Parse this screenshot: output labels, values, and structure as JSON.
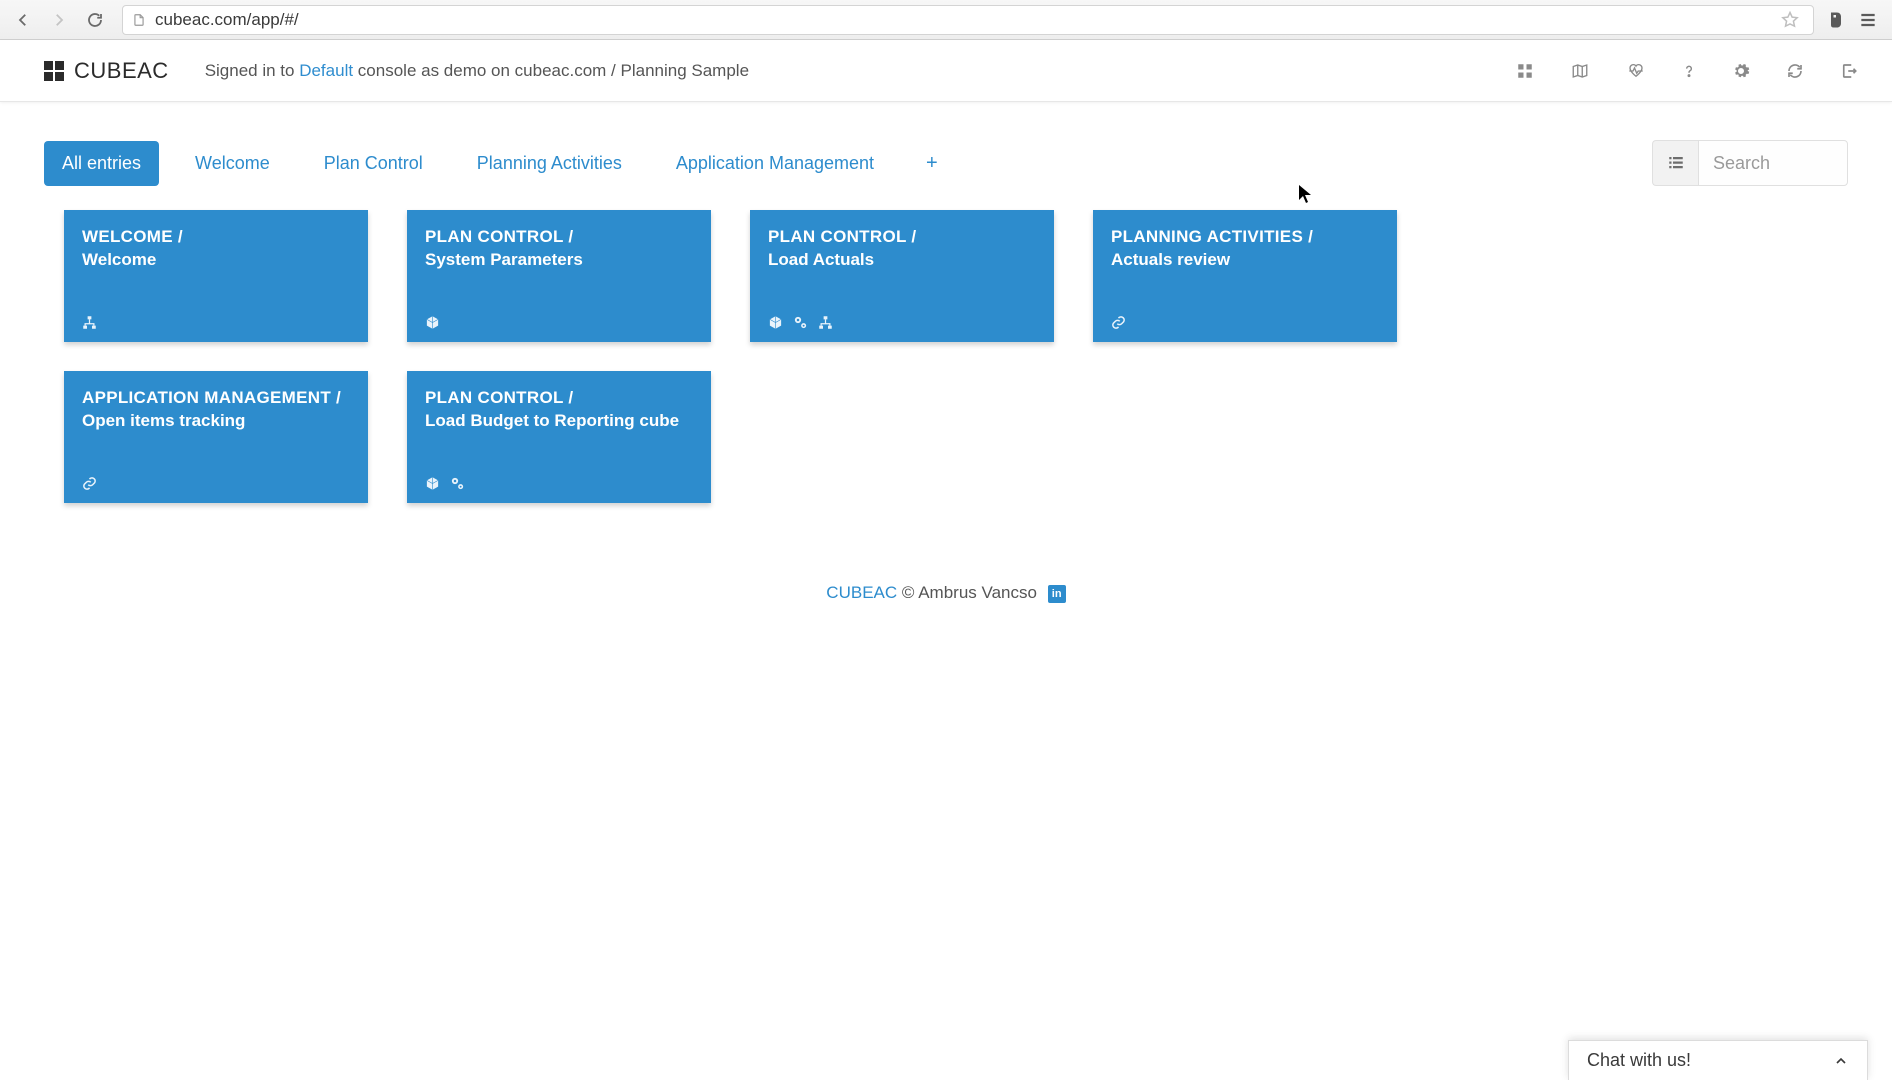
{
  "browser": {
    "url": "cubeac.com/app/#/"
  },
  "header": {
    "brand": "CUBEAC",
    "signed_in_prefix": "Signed in to ",
    "signed_in_link": "Default",
    "signed_in_suffix": " console as demo on cubeac.com / Planning Sample"
  },
  "tabs": [
    {
      "label": "All entries",
      "active": true
    },
    {
      "label": "Welcome",
      "active": false
    },
    {
      "label": "Plan Control",
      "active": false
    },
    {
      "label": "Planning Activities",
      "active": false
    },
    {
      "label": "Application Management",
      "active": false
    }
  ],
  "add_tab_label": "+",
  "search": {
    "placeholder": "Search"
  },
  "cards": [
    {
      "category": "WELCOME /",
      "title": "Welcome",
      "icons": [
        "sitemap"
      ]
    },
    {
      "category": "PLAN CONTROL /",
      "title": "System Parameters",
      "icons": [
        "cube"
      ]
    },
    {
      "category": "PLAN CONTROL /",
      "title": "Load Actuals",
      "icons": [
        "cube",
        "gears",
        "sitemap"
      ]
    },
    {
      "category": "PLANNING ACTIVITIES /",
      "title": "Actuals review",
      "icons": [
        "link"
      ]
    },
    {
      "category": "APPLICATION MANAGEMENT /",
      "title": "Open items tracking",
      "icons": [
        "link"
      ]
    },
    {
      "category": "PLAN CONTROL /",
      "title": "Load Budget to Reporting cube",
      "icons": [
        "cube",
        "gears"
      ]
    }
  ],
  "footer": {
    "brand": "CUBEAC",
    "copyright_symbol": "©",
    "author": "Ambrus Vancso",
    "linkedin_label": "in"
  },
  "chat": {
    "label": "Chat with us!"
  }
}
